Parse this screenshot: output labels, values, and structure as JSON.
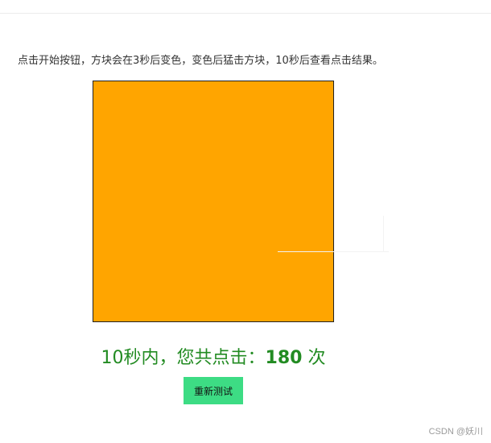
{
  "instructions": "点击开始按钮，方块会在3秒后变色，变色后猛击方块，10秒后查看点击结果。",
  "target": {
    "color": "#ffa500"
  },
  "result": {
    "prefix": "10秒内，您共点击：",
    "count": "180",
    "suffix": " 次",
    "color": "#228b22"
  },
  "retest_button": {
    "label": "重新测试",
    "color": "#3ddc84"
  },
  "watermark": "CSDN @妖川"
}
